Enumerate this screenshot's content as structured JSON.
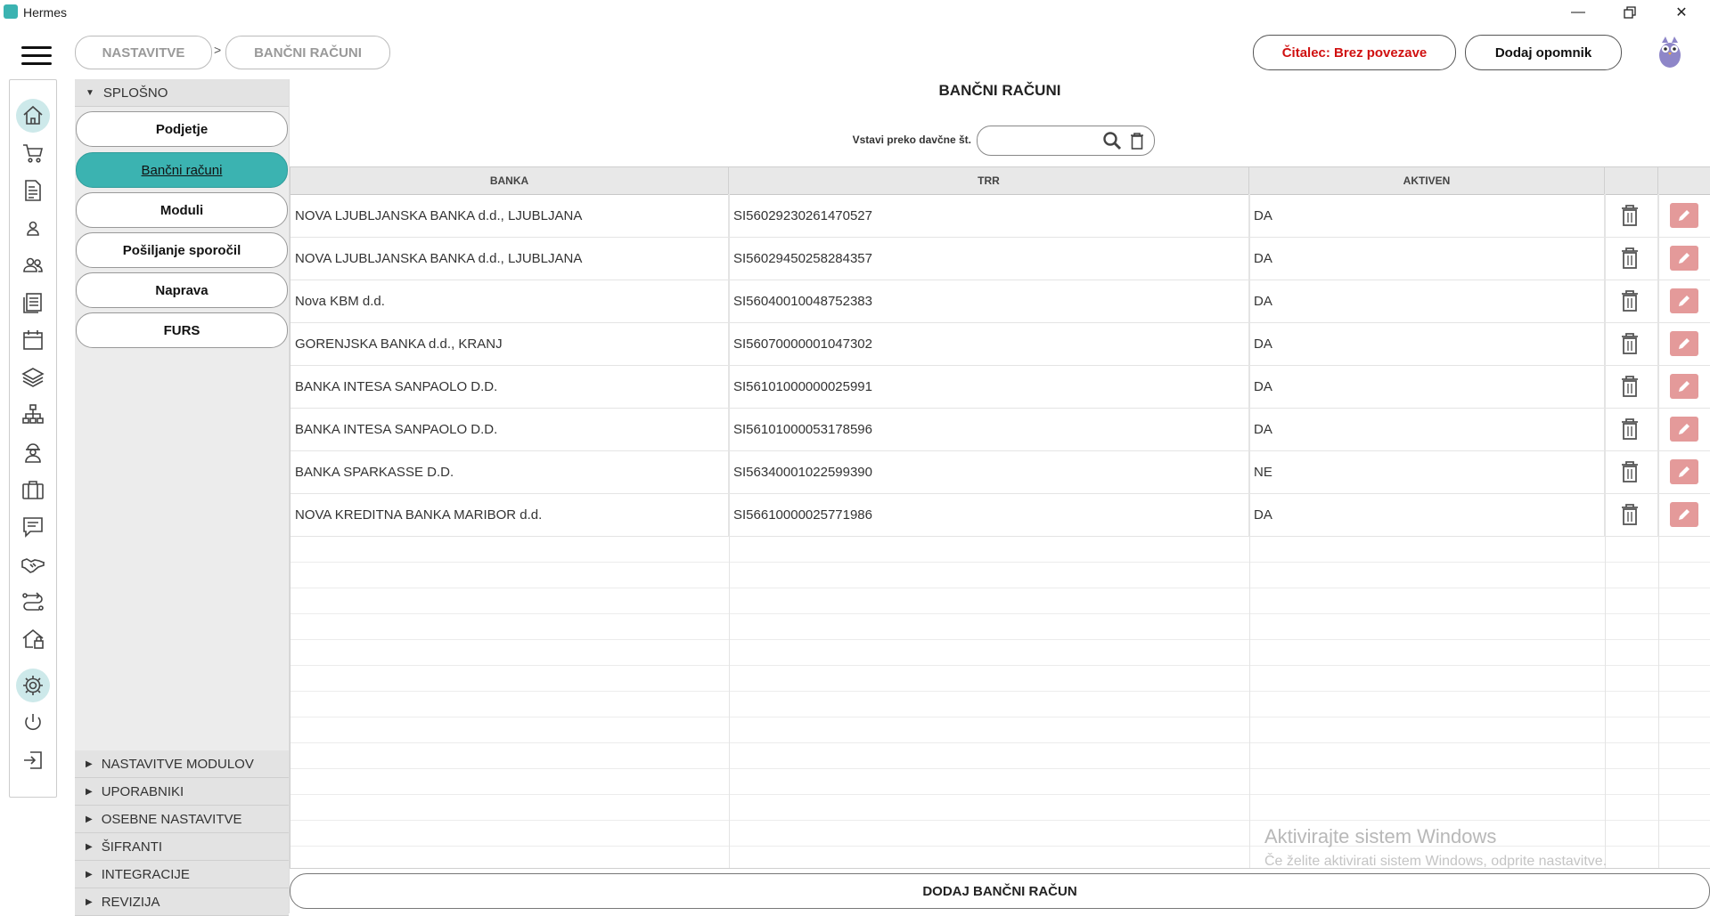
{
  "window": {
    "title": "Hermes"
  },
  "breadcrumb": {
    "items": [
      "NASTAVITVE",
      "BANČNI RAČUNI"
    ],
    "separator": ">"
  },
  "header": {
    "reader_status": "Čitalec: Brez povezave",
    "add_reminder": "Dodaj opomnik"
  },
  "rail": {
    "icons": [
      "home-icon",
      "cart-icon",
      "document-icon",
      "person-icon",
      "people-icon",
      "news-icon",
      "calendar-icon",
      "layers-icon",
      "network-icon",
      "worker-icon",
      "briefcase-icon",
      "chat-icon",
      "handshake-icon",
      "route-icon",
      "house-icon",
      "settings-icon",
      "power-icon",
      "logout-icon"
    ],
    "active": "home-icon"
  },
  "side": {
    "general_section": "SPLOŠNO",
    "items": [
      "Podjetje",
      "Bančni računi",
      "Moduli",
      "Pošiljanje sporočil",
      "Naprava",
      "FURS"
    ],
    "active_item": "Bančni računi",
    "collapsed_sections": [
      "NASTAVITVE MODULOV",
      "UPORABNIKI",
      "OSEBNE NASTAVITVE",
      "ŠIFRANTI",
      "INTEGRACIJE",
      "REVIZIJA"
    ]
  },
  "main": {
    "title": "BANČNI RAČUNI",
    "search_label": "Vstavi preko davčne št.",
    "search_value": "",
    "columns": [
      "BANKA",
      "TRR",
      "AKTIVEN"
    ],
    "rows": [
      {
        "bank": "NOVA LJUBLJANSKA BANKA d.d., LJUBLJANA",
        "trr": "SI56029230261470527",
        "active": "DA"
      },
      {
        "bank": "NOVA LJUBLJANSKA BANKA d.d., LJUBLJANA",
        "trr": "SI56029450258284357",
        "active": "DA"
      },
      {
        "bank": "Nova KBM d.d.",
        "trr": "SI56040010048752383",
        "active": "DA"
      },
      {
        "bank": "GORENJSKA BANKA d.d., KRANJ",
        "trr": "SI56070000001047302",
        "active": "DA"
      },
      {
        "bank": "BANKA INTESA SANPAOLO D.D.",
        "trr": "SI56101000000025991",
        "active": "DA"
      },
      {
        "bank": "BANKA INTESA SANPAOLO D.D.",
        "trr": "SI56101000053178596",
        "active": "DA"
      },
      {
        "bank": "BANKA SPARKASSE D.D.",
        "trr": "SI56340001022599390",
        "active": "NE"
      },
      {
        "bank": "NOVA KREDITNA BANKA MARIBOR d.d.",
        "trr": "SI56610000025771986",
        "active": "DA"
      }
    ],
    "add_button": "DODAJ BANČNI RAČUN"
  },
  "watermark": {
    "line1": "Aktivirajte sistem Windows",
    "line2": "Če želite aktivirati sistem Windows, odprite nastavitve."
  },
  "colors": {
    "accent": "#3bb3b1",
    "edit": "#e49a9a",
    "status_red": "#d01010"
  }
}
